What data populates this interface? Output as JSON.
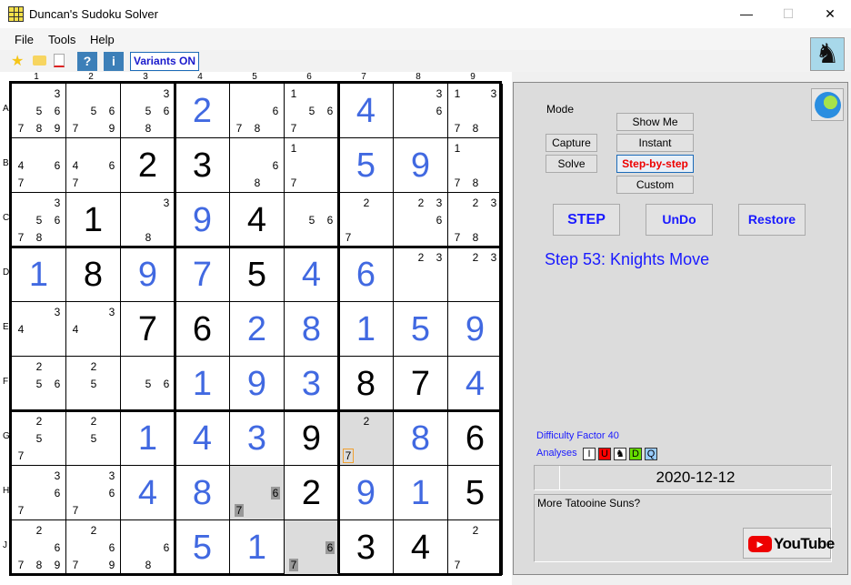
{
  "window": {
    "title": "Duncan's Sudoku Solver",
    "minimize": "—",
    "maximize": "☐",
    "close": "✕"
  },
  "menu": [
    "File",
    "Tools",
    "Help"
  ],
  "toolbar": {
    "star": "★",
    "help": "?",
    "info": "i",
    "variants": "Variants ON"
  },
  "columns": [
    "1",
    "2",
    "3",
    "4",
    "5",
    "6",
    "7",
    "8",
    "9"
  ],
  "rows": [
    "A",
    "B",
    "C",
    "D",
    "E",
    "F",
    "G",
    "H",
    "J"
  ],
  "grid": [
    [
      {
        "c": [
          3,
          5,
          6,
          7,
          8,
          9
        ]
      },
      {
        "c": [
          5,
          6,
          7,
          9
        ]
      },
      {
        "c": [
          3,
          5,
          6,
          8
        ]
      },
      {
        "v": 2,
        "t": "s"
      },
      {
        "c": [
          6,
          7,
          8
        ]
      },
      {
        "c": [
          1,
          5,
          6,
          7
        ]
      },
      {
        "v": 4,
        "t": "s"
      },
      {
        "c": [
          3,
          6
        ]
      },
      {
        "c": [
          1,
          3,
          7,
          8
        ]
      }
    ],
    [
      {
        "c": [
          4,
          6,
          7
        ]
      },
      {
        "c": [
          4,
          6,
          7
        ]
      },
      {
        "v": 2,
        "t": "g"
      },
      {
        "v": 3,
        "t": "g"
      },
      {
        "c": [
          6,
          8
        ]
      },
      {
        "c": [
          1,
          7
        ]
      },
      {
        "v": 5,
        "t": "s"
      },
      {
        "v": 9,
        "t": "s"
      },
      {
        "c": [
          1,
          7,
          8
        ]
      }
    ],
    [
      {
        "c": [
          3,
          5,
          6,
          7,
          8
        ]
      },
      {
        "v": 1,
        "t": "g"
      },
      {
        "c": [
          3,
          8
        ]
      },
      {
        "v": 9,
        "t": "s"
      },
      {
        "v": 4,
        "t": "g"
      },
      {
        "c": [
          5,
          6
        ]
      },
      {
        "c": [
          2,
          7
        ]
      },
      {
        "c": [
          2,
          3,
          6
        ]
      },
      {
        "c": [
          2,
          3,
          7,
          8
        ]
      }
    ],
    [
      {
        "v": 1,
        "t": "s"
      },
      {
        "v": 8,
        "t": "g"
      },
      {
        "v": 9,
        "t": "s"
      },
      {
        "v": 7,
        "t": "s"
      },
      {
        "v": 5,
        "t": "g"
      },
      {
        "v": 4,
        "t": "s"
      },
      {
        "v": 6,
        "t": "s"
      },
      {
        "c": [
          2,
          3
        ]
      },
      {
        "c": [
          2,
          3
        ]
      }
    ],
    [
      {
        "c": [
          3,
          4
        ]
      },
      {
        "c": [
          3,
          4
        ]
      },
      {
        "v": 7,
        "t": "g"
      },
      {
        "v": 6,
        "t": "g"
      },
      {
        "v": 2,
        "t": "s"
      },
      {
        "v": 8,
        "t": "s"
      },
      {
        "v": 1,
        "t": "s"
      },
      {
        "v": 5,
        "t": "s"
      },
      {
        "v": 9,
        "t": "s"
      }
    ],
    [
      {
        "c": [
          2,
          5,
          6
        ]
      },
      {
        "c": [
          2,
          5
        ]
      },
      {
        "c": [
          5,
          6
        ]
      },
      {
        "v": 1,
        "t": "s"
      },
      {
        "v": 9,
        "t": "s"
      },
      {
        "v": 3,
        "t": "s"
      },
      {
        "v": 8,
        "t": "g"
      },
      {
        "v": 7,
        "t": "g"
      },
      {
        "v": 4,
        "t": "s"
      }
    ],
    [
      {
        "c": [
          2,
          5,
          7
        ]
      },
      {
        "c": [
          2,
          5
        ]
      },
      {
        "v": 1,
        "t": "s"
      },
      {
        "v": 4,
        "t": "s"
      },
      {
        "v": 3,
        "t": "s"
      },
      {
        "v": 9,
        "t": "g"
      },
      {
        "c": [
          2,
          7
        ],
        "hl": true,
        "ring": [
          7
        ]
      },
      {
        "v": 8,
        "t": "s"
      },
      {
        "v": 6,
        "t": "g"
      }
    ],
    [
      {
        "c": [
          3,
          6,
          7
        ]
      },
      {
        "c": [
          3,
          6,
          7
        ]
      },
      {
        "v": 4,
        "t": "s"
      },
      {
        "v": 8,
        "t": "s"
      },
      {
        "c": [
          6,
          7
        ],
        "hl": true,
        "mark": [
          6,
          7
        ]
      },
      {
        "v": 2,
        "t": "g"
      },
      {
        "v": 9,
        "t": "s"
      },
      {
        "v": 1,
        "t": "s"
      },
      {
        "v": 5,
        "t": "g"
      }
    ],
    [
      {
        "c": [
          2,
          6,
          7,
          8,
          9
        ]
      },
      {
        "c": [
          2,
          6,
          7,
          9
        ]
      },
      {
        "c": [
          6,
          8
        ]
      },
      {
        "v": 5,
        "t": "s"
      },
      {
        "v": 1,
        "t": "s"
      },
      {
        "c": [
          6,
          7
        ],
        "hl": true,
        "mark": [
          6,
          7
        ]
      },
      {
        "v": 3,
        "t": "g"
      },
      {
        "v": 4,
        "t": "g"
      },
      {
        "c": [
          2,
          7
        ]
      }
    ]
  ],
  "panel": {
    "mode_label": "Mode",
    "capture": "Capture",
    "solve": "Solve",
    "show_me": "Show Me",
    "instant": "Instant",
    "step_by_step": "Step-by-step",
    "custom": "Custom",
    "step": "STEP",
    "undo": "UnDo",
    "restore": "Restore",
    "status": "Step 53: Knights Move",
    "difficulty": "Difficulty Factor 40",
    "analyses_label": "Analyses",
    "analyses": [
      {
        "label": "I",
        "color": "#ffffff"
      },
      {
        "label": "U",
        "color": "#ff0000"
      },
      {
        "label": "♞",
        "color": "#ffffff"
      },
      {
        "label": "D",
        "color": "#66dd00"
      },
      {
        "label": "Q",
        "color": "#99ccff"
      }
    ],
    "date": "2020-12-12",
    "notes": "More Tatooine Suns?",
    "youtube": "YouTube"
  }
}
